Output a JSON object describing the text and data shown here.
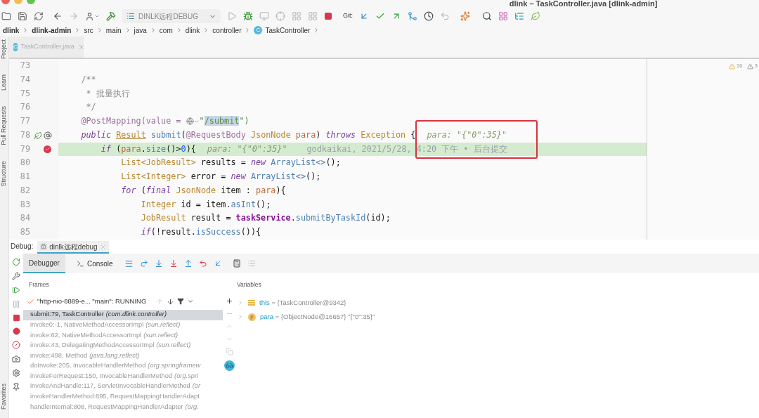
{
  "window": {
    "title": "dlink – TaskController.java [dlink-admin]"
  },
  "toolbar": {
    "run_config": "DINLK远程DEBUG",
    "git_label": "Git:"
  },
  "breadcrumb": [
    {
      "label": "dlink",
      "kind": "project"
    },
    {
      "label": "dlink-admin",
      "kind": "module"
    },
    {
      "label": "src",
      "kind": "folder"
    },
    {
      "label": "main",
      "kind": "folder"
    },
    {
      "label": "java",
      "kind": "folder"
    },
    {
      "label": "com",
      "kind": "folder"
    },
    {
      "label": "dlink",
      "kind": "folder"
    },
    {
      "label": "controller",
      "kind": "folder"
    },
    {
      "label": "TaskController",
      "kind": "class",
      "icon_letter": "C"
    }
  ],
  "tool_stripe": {
    "top": [
      "Project",
      "Learn",
      "Pull Requests",
      "Structure"
    ],
    "bottom": [
      "Favorites"
    ]
  },
  "editor": {
    "tabs": [
      {
        "label": "TaskController.java",
        "icon_letter": "C",
        "selected": true
      }
    ],
    "warnings": [
      {
        "count": "16"
      },
      {
        "count": "3"
      }
    ],
    "lines": [
      {
        "number": "73",
        "current": false
      },
      {
        "number": "74",
        "current": false,
        "tokens": [
          {
            "text": "    /**",
            "kind": "comment"
          }
        ]
      },
      {
        "number": "75",
        "current": false,
        "tokens": [
          {
            "text": "     * 批量执行",
            "kind": "comment"
          }
        ]
      },
      {
        "number": "76",
        "current": false,
        "tokens": [
          {
            "text": "     */",
            "kind": "comment"
          }
        ]
      },
      {
        "number": "77",
        "current": false,
        "tokens": [
          {
            "text": "    @PostMapping(value = ",
            "kind": "annotation"
          },
          {
            "kind": "url-icon"
          },
          {
            "text": "\"",
            "kind": "string"
          },
          {
            "text": "/submit",
            "kind": "string-match"
          },
          {
            "text": "\")",
            "kind": "string"
          }
        ]
      },
      {
        "number": "78",
        "current": false,
        "markers": [
          {
            "kind": "bean"
          },
          {
            "kind": "mapping"
          }
        ],
        "tokens": [
          {
            "text": "    public ",
            "kind": "keyword"
          },
          {
            "text": "Result",
            "kind": "type-link"
          },
          {
            "text": " submit",
            "kind": "method"
          },
          {
            "text": "(",
            "kind": "plain"
          },
          {
            "text": "@RequestBody",
            "kind": "annotation"
          },
          {
            "text": " JsonNode ",
            "kind": "type"
          },
          {
            "text": "para",
            "kind": "param"
          },
          {
            "text": ") ",
            "kind": "plain"
          },
          {
            "text": "throws",
            "kind": "keyword"
          },
          {
            "text": " Exception",
            "kind": "type"
          },
          {
            "text": " {",
            "kind": "plain"
          },
          {
            "text": "para: \"{\"0\":35}\"",
            "kind": "hint"
          }
        ]
      },
      {
        "number": "79",
        "current": true,
        "markers": [
          {
            "kind": "breakpoint"
          }
        ],
        "tokens": [
          {
            "text": "        if",
            "kind": "keyword"
          },
          {
            "text": " (",
            "kind": "plain"
          },
          {
            "text": "para",
            "kind": "param"
          },
          {
            "text": ".",
            "kind": "plain"
          },
          {
            "text": "size",
            "kind": "method"
          },
          {
            "text": "()>",
            "kind": "plain"
          },
          {
            "text": "0",
            "kind": "number"
          },
          {
            "text": "){",
            "kind": "plain"
          },
          {
            "text": "para: \"{\"0\":35}\"",
            "kind": "hint"
          },
          {
            "text": "godkaikai, 2021/5/28, 4:20 下午 • 后台提交",
            "kind": "blame"
          }
        ]
      },
      {
        "number": "80",
        "current": false,
        "tokens": [
          {
            "text": "            List<JobResult>",
            "kind": "type"
          },
          {
            "text": " results = ",
            "kind": "plain"
          },
          {
            "text": "new",
            "kind": "keyword"
          },
          {
            "text": " ArrayList<>",
            "kind": "method"
          },
          {
            "text": "();",
            "kind": "plain"
          }
        ]
      },
      {
        "number": "81",
        "current": false,
        "tokens": [
          {
            "text": "            List<Integer>",
            "kind": "type"
          },
          {
            "text": " error = ",
            "kind": "plain"
          },
          {
            "text": "new",
            "kind": "keyword"
          },
          {
            "text": " ArrayList<>",
            "kind": "method"
          },
          {
            "text": "();",
            "kind": "plain"
          }
        ]
      },
      {
        "number": "82",
        "current": false,
        "tokens": [
          {
            "text": "            for",
            "kind": "keyword"
          },
          {
            "text": " (",
            "kind": "plain"
          },
          {
            "text": "final",
            "kind": "keyword"
          },
          {
            "text": " JsonNode",
            "kind": "type"
          },
          {
            "text": " item : ",
            "kind": "plain"
          },
          {
            "text": "para",
            "kind": "param"
          },
          {
            "text": "){",
            "kind": "plain"
          }
        ]
      },
      {
        "number": "83",
        "current": false,
        "tokens": [
          {
            "text": "                Integer",
            "kind": "type"
          },
          {
            "text": " id = item.",
            "kind": "plain"
          },
          {
            "text": "asInt",
            "kind": "method"
          },
          {
            "text": "();",
            "kind": "plain"
          }
        ]
      },
      {
        "number": "84",
        "current": false,
        "tokens": [
          {
            "text": "                JobResult",
            "kind": "type"
          },
          {
            "text": " result = ",
            "kind": "plain"
          },
          {
            "text": "taskService",
            "kind": "field"
          },
          {
            "text": ".",
            "kind": "plain"
          },
          {
            "text": "submitByTaskId",
            "kind": "method"
          },
          {
            "text": "(id);",
            "kind": "plain"
          }
        ]
      },
      {
        "number": "85",
        "current": false,
        "tokens": [
          {
            "text": "                if",
            "kind": "keyword"
          },
          {
            "text": "(!result.",
            "kind": "plain"
          },
          {
            "text": "isSuccess",
            "kind": "method"
          },
          {
            "text": "()){",
            "kind": "plain"
          }
        ]
      }
    ]
  },
  "debug": {
    "label": "Debug:",
    "sessions": [
      {
        "label": "dinlk远程debug",
        "selected": true
      }
    ],
    "tabs": [
      {
        "label": "Debugger",
        "kind": "debugger",
        "selected": true
      },
      {
        "label": "Console",
        "kind": "console",
        "selected": false
      }
    ],
    "frames": {
      "title": "Frames",
      "thread": "\"http-nio-8889-e... \"main\": RUNNING",
      "items": [
        {
          "method": "submit:79, TaskController",
          "package": "(com.dlink.controller)",
          "selected": true
        },
        {
          "method": "invoke0:-1, NativeMethodAccessorImpl",
          "package": "(sun.reflect)",
          "selected": false
        },
        {
          "method": "invoke:62, NativeMethodAccessorImpl",
          "package": "(sun.reflect)",
          "selected": false
        },
        {
          "method": "invoke:43, DelegatingMethodAccessorImpl",
          "package": "(sun.reflect)",
          "selected": false
        },
        {
          "method": "invoke:498, Method",
          "package": "(java.lang.reflect)",
          "selected": false
        },
        {
          "method": "doInvoke:205, InvocableHandlerMethod",
          "package": "(org.springframew",
          "selected": false
        },
        {
          "method": "invokeForRequest:150, InvocableHandlerMethod",
          "package": "(org.spri",
          "selected": false
        },
        {
          "method": "invokeAndHandle:117, ServletInvocableHandlerMethod",
          "package": "(or",
          "selected": false
        },
        {
          "method": "invokeHandlerMethod:895, RequestMappingHandlerAdapt",
          "selected": false
        },
        {
          "method": "handleInternal:808, RequestMappingHandlerAdapter",
          "package": "(org.",
          "selected": false
        }
      ]
    },
    "variables": {
      "title": "Variables",
      "items": [
        {
          "kind": "object",
          "name": "this",
          "value": "= {TaskController@9342}"
        },
        {
          "kind": "parameter",
          "badge": "p",
          "name": "para",
          "value": "= {ObjectNode@16657} \"{\"0\":35}\""
        }
      ]
    }
  }
}
